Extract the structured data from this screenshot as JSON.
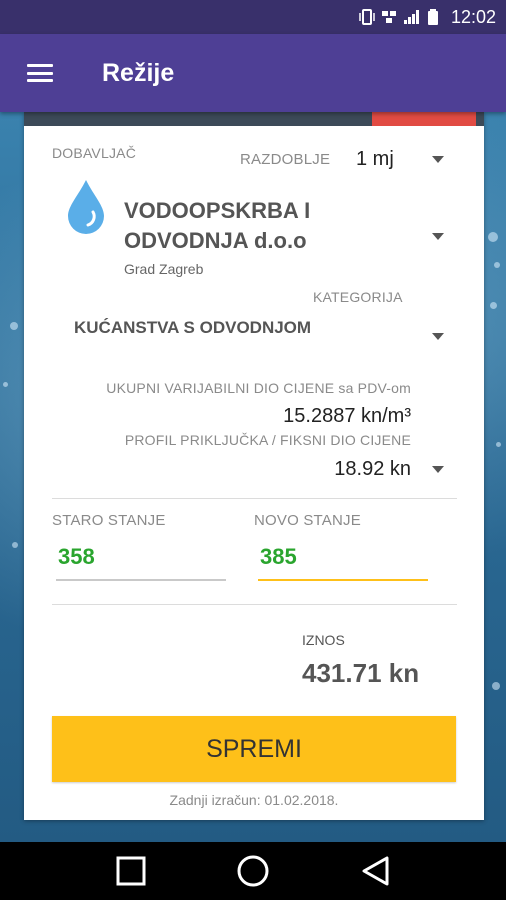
{
  "status_bar": {
    "time": "12:02",
    "icons": [
      "vibrate-icon",
      "network-icon",
      "signal-icon",
      "battery-icon"
    ],
    "color": "#39306b"
  },
  "app_bar": {
    "title": "Režije",
    "menu_icon": "hamburger-menu-icon",
    "color": "#4e3f95"
  },
  "form": {
    "supplier_label": "DOBAVLJAČ",
    "period_label": "RAZDOBLJE",
    "period_value": "1 mj",
    "supplier_icon": "water-drop-icon",
    "supplier_name_line1": "VODOOPSKRBA I",
    "supplier_name_line2": "ODVODNJA d.o.o",
    "supplier_city": "Grad Zagreb",
    "category_label": "KATEGORIJA",
    "category_value": "KUĆANSTVA S ODVODNJOM",
    "variable_price_label": "UKUPNI VARIJABILNI DIO CIJENE sa PDV-om",
    "variable_price_value": "15.2887 kn/m³",
    "fixed_price_label": "PROFIL PRIKLJUČKA / FIKSNI DIO CIJENE",
    "fixed_price_value": "18.92 kn",
    "old_reading_label": "STARO STANJE",
    "old_reading_value": "358",
    "new_reading_label": "NOVO STANJE",
    "new_reading_value": "385",
    "amount_label": "IZNOS",
    "amount_value": "431.71 kn",
    "save_label": "SPREMI",
    "last_calc": "Zadnji izračun: 01.02.2018.",
    "accent_color": "#fec019",
    "value_color": "#2aa52e"
  },
  "nav_bar": {
    "buttons": [
      "recents-square-icon",
      "home-circle-icon",
      "back-triangle-icon"
    ]
  }
}
